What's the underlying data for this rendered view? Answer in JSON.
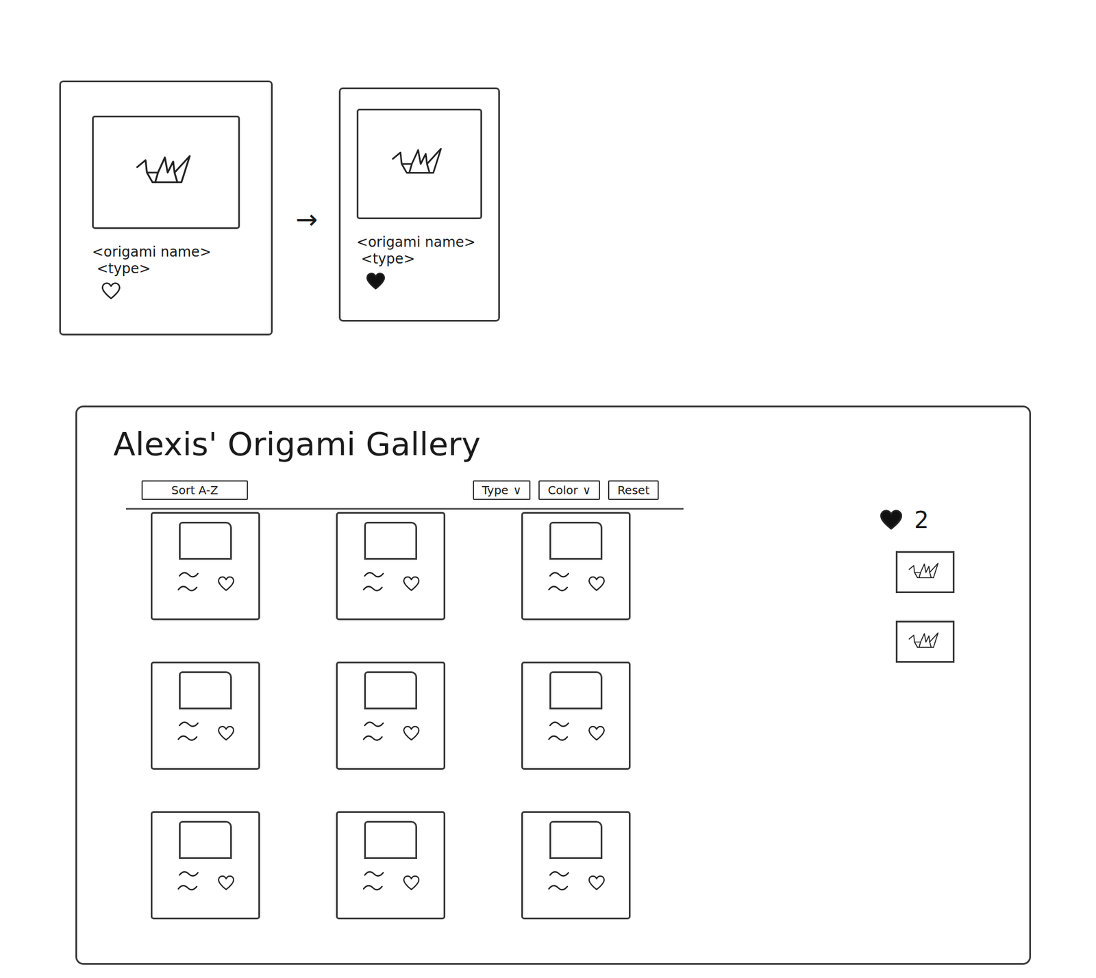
{
  "example": {
    "cards": [
      {
        "name": "<origami name>",
        "type": "<type>",
        "liked": false
      },
      {
        "name": "<origami name>",
        "type": "<type>",
        "liked": true
      }
    ],
    "arrow": "→"
  },
  "gallery": {
    "title": "Alexis' Origami Gallery",
    "sort": "Sort A-Z",
    "filters": [
      {
        "label": "Type",
        "caret": "∨"
      },
      {
        "label": "Color",
        "caret": "∨"
      }
    ],
    "reset": "Reset",
    "items": [
      {
        "liked": false
      },
      {
        "liked": false
      },
      {
        "liked": false
      },
      {
        "liked": false
      },
      {
        "liked": false
      },
      {
        "liked": false
      },
      {
        "liked": false
      },
      {
        "liked": false
      },
      {
        "liked": false
      }
    ],
    "favorites": {
      "count": "2",
      "items": [
        {
          "kind": "thumbnail"
        },
        {
          "kind": "thumbnail"
        }
      ]
    }
  }
}
